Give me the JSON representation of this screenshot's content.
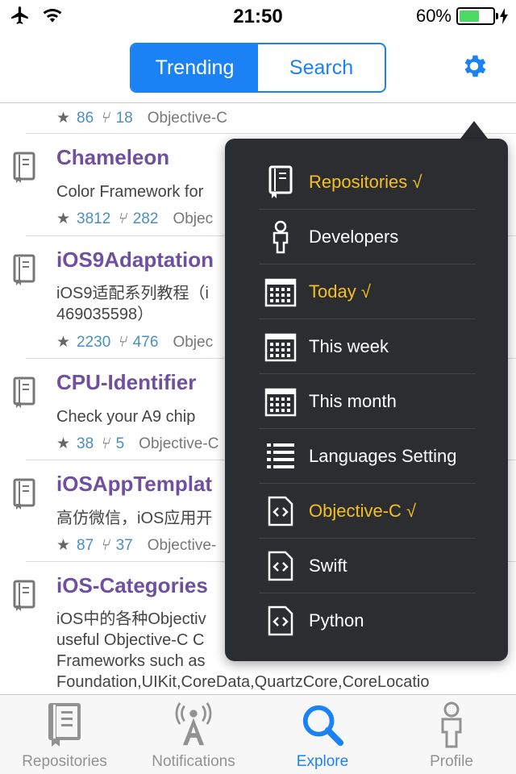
{
  "status_bar": {
    "time": "21:50",
    "battery_percent": "60%",
    "battery_level": 0.6
  },
  "nav": {
    "segments": [
      {
        "label": "Trending",
        "active": true
      },
      {
        "label": "Search",
        "active": false
      }
    ],
    "settings_icon": "gear-icon"
  },
  "repos": [
    {
      "name": "",
      "description": "",
      "stars": "86",
      "forks": "18",
      "language": "Objective-C"
    },
    {
      "name": "Chameleon",
      "description": "Color Framework for",
      "stars": "3812",
      "forks": "282",
      "language": "Objec"
    },
    {
      "name": "iOS9Adaptation",
      "description": "iOS9适配系列教程（i",
      "description2": "469035598）",
      "stars": "2230",
      "forks": "476",
      "language": "Objec"
    },
    {
      "name": "CPU-Identifier",
      "description": "Check your A9 chip",
      "stars": "38",
      "forks": "5",
      "language": "Objective-C"
    },
    {
      "name": "iOSAppTemplat",
      "description": "高仿微信，iOS应用开",
      "stars": "87",
      "forks": "37",
      "language": "Objective-"
    },
    {
      "name": "iOS-Categories",
      "description": "iOS中的各种Objectiv",
      "description2": "useful Objective-C C",
      "description3": "Frameworks such as",
      "description4": "Foundation,UIKit,CoreData,QuartzCore,CoreLocatio"
    }
  ],
  "menu": {
    "items": [
      {
        "label": "Repositories √",
        "icon": "repo-book-icon",
        "selected": true
      },
      {
        "label": "Developers",
        "icon": "person-icon",
        "selected": false
      },
      {
        "label": "Today √",
        "icon": "calendar-icon",
        "selected": true
      },
      {
        "label": "This week",
        "icon": "calendar-icon",
        "selected": false
      },
      {
        "label": "This month",
        "icon": "calendar-icon",
        "selected": false
      },
      {
        "label": "Languages Setting",
        "icon": "list-icon",
        "selected": false
      },
      {
        "label": "Objective-C √",
        "icon": "code-file-icon",
        "selected": true
      },
      {
        "label": "Swift",
        "icon": "code-file-icon",
        "selected": false
      },
      {
        "label": "Python",
        "icon": "code-file-icon",
        "selected": false
      }
    ]
  },
  "tabs": [
    {
      "label": "Repositories",
      "icon": "book-icon",
      "active": false
    },
    {
      "label": "Notifications",
      "icon": "antenna-icon",
      "active": false
    },
    {
      "label": "Explore",
      "icon": "search-icon",
      "active": true
    },
    {
      "label": "Profile",
      "icon": "person-icon",
      "active": false
    }
  ],
  "colors": {
    "accent": "#1a82f5",
    "repo_name": "#6f4fa0",
    "menu_bg": "#2b2d31",
    "menu_selected": "#f5c01e",
    "battery": "#4cd964"
  }
}
